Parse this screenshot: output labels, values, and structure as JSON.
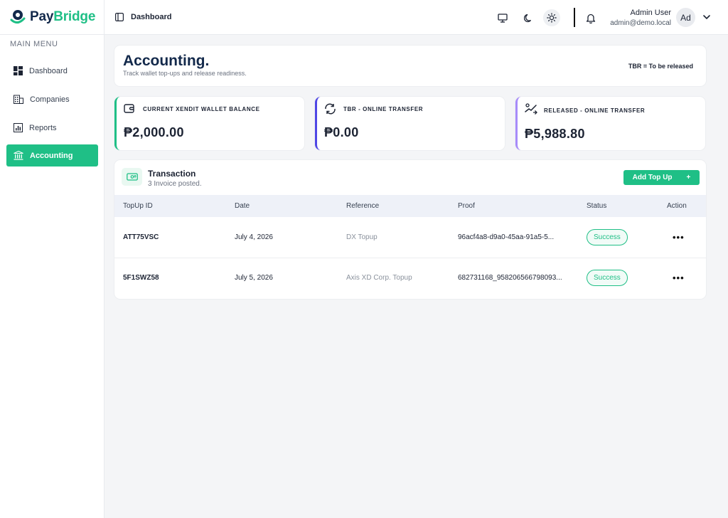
{
  "brand": {
    "part1": "Pay",
    "part2": "Bridge",
    "accent": "#1fbf86",
    "navy": "#13294b"
  },
  "sidebar": {
    "heading": "MAIN MENU",
    "items": [
      {
        "label": "Dashboard",
        "icon": "dashboard-grid-icon",
        "active": false
      },
      {
        "label": "Companies",
        "icon": "building-icon",
        "active": false
      },
      {
        "label": "Reports",
        "icon": "report-chart-icon",
        "active": false
      },
      {
        "label": "Accounting",
        "icon": "bank-icon",
        "active": true
      }
    ]
  },
  "header": {
    "title": "Dashboard",
    "icons": [
      "sidebar-toggle-icon",
      "monitor-icon",
      "moon-icon",
      "sun-icon",
      "bell-icon",
      "chevron-down-icon"
    ],
    "user": {
      "name": "Admin User",
      "email": "admin@demo.local",
      "initials": "Ad"
    }
  },
  "page": {
    "title": "Accounting.",
    "subtitle": "Track wallet top-ups and release readiness.",
    "note": "TBR = To be released"
  },
  "stats": [
    {
      "label": "Current Xendit Wallet Balance",
      "value": "₱2,000.00",
      "icon": "wallet-icon",
      "color": "#1fbf86"
    },
    {
      "label": "TBR - Online Transfer",
      "value": "₱0.00",
      "icon": "transfer-icon",
      "color": "#4f46e5"
    },
    {
      "label": "Released - Online Transfer",
      "value": "₱5,988.80",
      "icon": "released-transfer-icon",
      "color": "#a78bfa"
    }
  ],
  "transactions": {
    "title": "Transaction",
    "subtitle": "3 Invoice posted.",
    "add_button": "Add Top Up",
    "add_button_icon": "+",
    "columns": [
      "TopUp ID",
      "Date",
      "Reference",
      "Proof",
      "Status",
      "Action"
    ],
    "rows": [
      {
        "id": "ATT75VSC",
        "date": "July 4, 2026",
        "reference": "DX Topup",
        "proof": "96acf4a8-d9a0-45aa-91a5-5...",
        "status": "Success",
        "action": "•••"
      },
      {
        "id": "5F1SWZ58",
        "date": "July 5, 2026",
        "reference": "Axis XD Corp. Topup",
        "proof": "682731168_958206566798093...",
        "status": "Success",
        "action": "•••"
      }
    ]
  }
}
